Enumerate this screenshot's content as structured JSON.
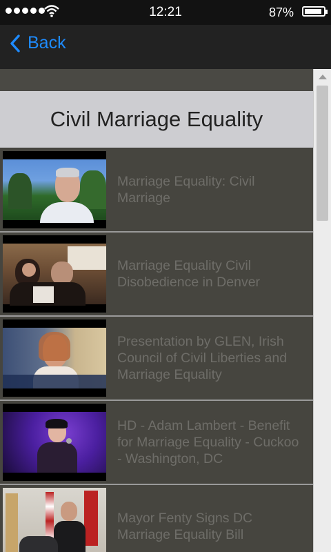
{
  "status": {
    "time": "12:21",
    "battery": "87%",
    "battery_level": 0.87
  },
  "nav": {
    "back_label": "Back"
  },
  "page": {
    "title": "Civil Marriage Equality"
  },
  "videos": [
    {
      "title": "Marriage Equality: Civil Marriage"
    },
    {
      "title": "Marriage Equality Civil Disobedience in Denver"
    },
    {
      "title": "Presentation by GLEN, Irish Council of Civil Liberties and Marriage Equality"
    },
    {
      "title": "HD - Adam Lambert - Benefit for Marriage Equality - Cuckoo - Washington, DC"
    },
    {
      "title": "Mayor Fenty Signs DC Marriage Equality Bill"
    }
  ],
  "colors": {
    "accent": "#1e8bff",
    "title_bar": "#cdcdd1",
    "list_bg": "#46453f",
    "item_text": "#6e6d68"
  }
}
